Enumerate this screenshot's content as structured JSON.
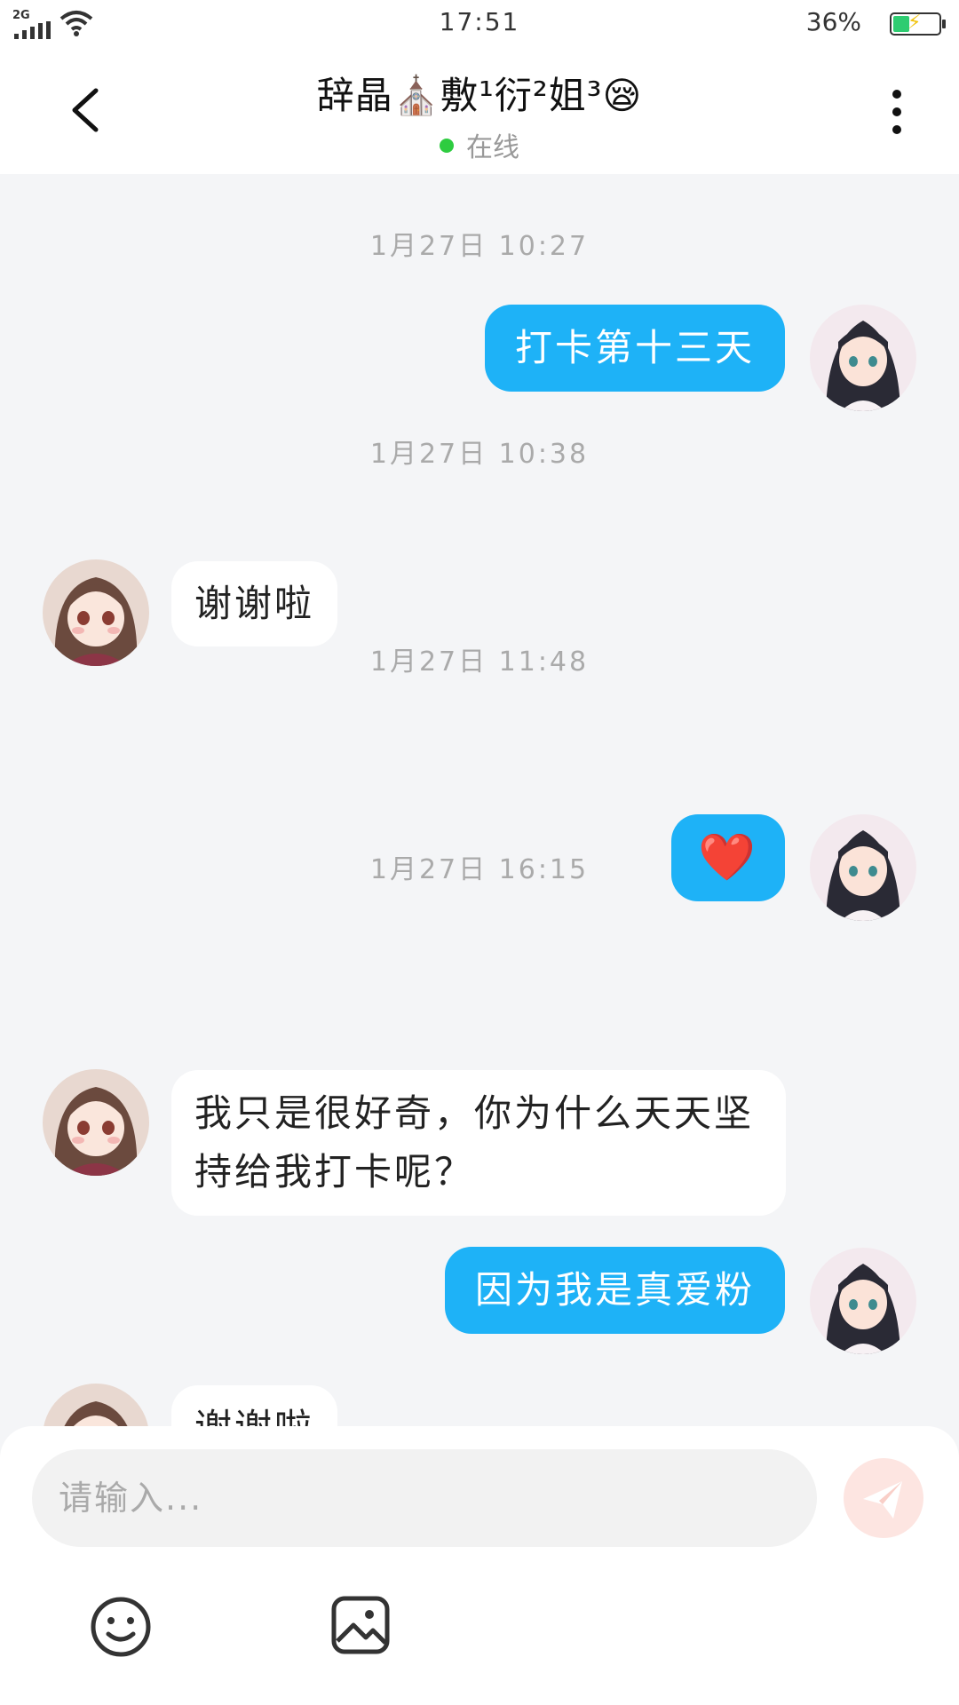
{
  "status_bar": {
    "network": "2G",
    "time": "17:51",
    "battery_percent_text": "36%",
    "battery_level": 0.36
  },
  "header": {
    "title": "辞晶⛪敷¹衍²姐³😪",
    "status": "在线",
    "back_icon": "chevron-left-icon",
    "more_icon": "vertical-dots-icon"
  },
  "messages": [
    {
      "type": "timestamp",
      "text": "1月27日 10:27"
    },
    {
      "type": "message",
      "side": "me",
      "text": "打卡第十三天"
    },
    {
      "type": "timestamp",
      "text": "1月27日 10:38"
    },
    {
      "type": "message",
      "side": "other",
      "text": "谢谢啦"
    },
    {
      "type": "timestamp",
      "text": "1月27日 11:48"
    },
    {
      "type": "message",
      "side": "me",
      "text": "❤️"
    },
    {
      "type": "timestamp",
      "text": "1月27日 16:15"
    },
    {
      "type": "message",
      "side": "other",
      "text": "我只是很好奇，你为什么天天坚持给我打卡呢？"
    },
    {
      "type": "message",
      "side": "me",
      "text": "因为我是真爱粉"
    },
    {
      "type": "message",
      "side": "other",
      "text": "谢谢啦"
    }
  ],
  "input": {
    "placeholder": "请输入...",
    "value": ""
  },
  "toolbar": {
    "emoji_icon": "smiley-icon",
    "image_icon": "image-icon",
    "send_icon": "paper-plane-icon"
  },
  "colors": {
    "my_bubble": "#1eb2f7",
    "other_bubble": "#ffffff",
    "background": "#f4f5f7",
    "online_dot": "#2ecc40",
    "send_button": "#fde5e1"
  }
}
